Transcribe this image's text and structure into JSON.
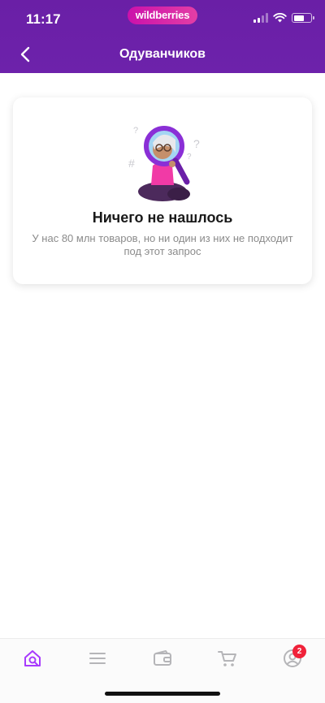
{
  "status_bar": {
    "time": "11:17",
    "logo_text": "wildberries"
  },
  "header": {
    "title": "Одуванчиков",
    "background_color": "#6b1fa8"
  },
  "empty_state": {
    "title": "Ничего не нашлось",
    "description": "У нас 80 млн товаров, но ни один из них не подходит под этот запрос",
    "illustration": "woman-with-magnifier-illustration"
  },
  "tab_bar": {
    "items": [
      {
        "icon": "home-search-icon",
        "active": true
      },
      {
        "icon": "menu-icon",
        "active": false
      },
      {
        "icon": "wallet-icon",
        "active": false
      },
      {
        "icon": "cart-icon",
        "active": false
      },
      {
        "icon": "profile-icon",
        "active": false
      }
    ],
    "profile_badge": "2",
    "active_color": "#a73afd",
    "inactive_color": "#b5b5b8",
    "badge_color": "#f0223a"
  }
}
